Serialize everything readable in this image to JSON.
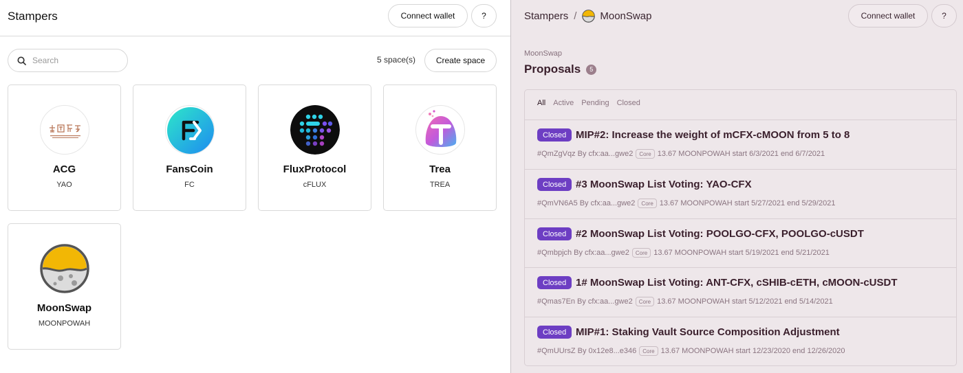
{
  "left": {
    "brand": "Stampers",
    "connect_label": "Connect wallet",
    "help_label": "?",
    "search_placeholder": "Search",
    "space_count": "5 space(s)",
    "create_label": "Create space",
    "cards": [
      {
        "name": "ACG",
        "symbol": "YAO",
        "icon": "acg-logo"
      },
      {
        "name": "FansCoin",
        "symbol": "FC",
        "icon": "fanscoin-logo"
      },
      {
        "name": "FluxProtocol",
        "symbol": "cFLUX",
        "icon": "fluxprotocol-logo"
      },
      {
        "name": "Trea",
        "symbol": "TREA",
        "icon": "trea-logo"
      },
      {
        "name": "MoonSwap",
        "symbol": "MOONPOWAH",
        "icon": "moonswap-logo"
      }
    ]
  },
  "right": {
    "breadcrumb_root": "Stampers",
    "breadcrumb_sep": "/",
    "breadcrumb_space": "MoonSwap",
    "connect_label": "Connect wallet",
    "help_label": "?",
    "sub_label": "MoonSwap",
    "title": "Proposals",
    "title_count": "5",
    "tabs": [
      "All",
      "Active",
      "Pending",
      "Closed"
    ],
    "active_tab": "All",
    "status_color": "#6d3ec3",
    "proposals": [
      {
        "status": "Closed",
        "title": "MIP#2: Increase the weight of mCFX-cMOON from 5 to 8",
        "id": "#QmZgVqz",
        "by": "By cfx:aa...gwe2",
        "tag": "Core",
        "power": "13.67 MOONPOWAH",
        "start": "start 6/3/2021",
        "end": "end 6/7/2021"
      },
      {
        "status": "Closed",
        "title": "#3 MoonSwap List Voting: YAO-CFX",
        "id": "#QmVN6A5",
        "by": "By cfx:aa...gwe2",
        "tag": "Core",
        "power": "13.67 MOONPOWAH",
        "start": "start 5/27/2021",
        "end": "end 5/29/2021"
      },
      {
        "status": "Closed",
        "title": "#2 MoonSwap List Voting: POOLGO-CFX, POOLGO-cUSDT",
        "id": "#Qmbpjch",
        "by": "By cfx:aa...gwe2",
        "tag": "Core",
        "power": "13.67 MOONPOWAH",
        "start": "start 5/19/2021",
        "end": "end 5/21/2021"
      },
      {
        "status": "Closed",
        "title": "1# MoonSwap List Voting: ANT-CFX, cSHIB-cETH, cMOON-cUSDT",
        "id": "#Qmas7En",
        "by": "By cfx:aa...gwe2",
        "tag": "Core",
        "power": "13.67 MOONPOWAH",
        "start": "start 5/12/2021",
        "end": "end 5/14/2021"
      },
      {
        "status": "Closed",
        "title": "MIP#1: Staking Vault Source Composition Adjustment",
        "id": "#QmUUrsZ",
        "by": "By 0x12e8...e346",
        "tag": "Core",
        "power": "13.67 MOONPOWAH",
        "start": "start 12/23/2020",
        "end": "end 12/26/2020"
      }
    ]
  }
}
